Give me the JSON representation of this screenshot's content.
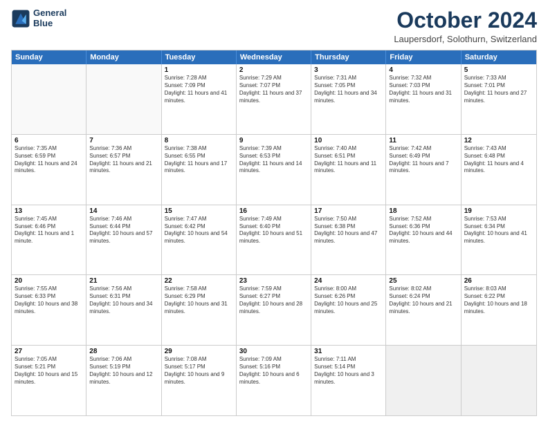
{
  "header": {
    "logo_line1": "General",
    "logo_line2": "Blue",
    "month_title": "October 2024",
    "subtitle": "Laupersdorf, Solothurn, Switzerland"
  },
  "weekdays": [
    "Sunday",
    "Monday",
    "Tuesday",
    "Wednesday",
    "Thursday",
    "Friday",
    "Saturday"
  ],
  "rows": [
    [
      {
        "day": "",
        "text": "",
        "empty": true
      },
      {
        "day": "",
        "text": "",
        "empty": true
      },
      {
        "day": "1",
        "text": "Sunrise: 7:28 AM\nSunset: 7:09 PM\nDaylight: 11 hours and 41 minutes."
      },
      {
        "day": "2",
        "text": "Sunrise: 7:29 AM\nSunset: 7:07 PM\nDaylight: 11 hours and 37 minutes."
      },
      {
        "day": "3",
        "text": "Sunrise: 7:31 AM\nSunset: 7:05 PM\nDaylight: 11 hours and 34 minutes."
      },
      {
        "day": "4",
        "text": "Sunrise: 7:32 AM\nSunset: 7:03 PM\nDaylight: 11 hours and 31 minutes."
      },
      {
        "day": "5",
        "text": "Sunrise: 7:33 AM\nSunset: 7:01 PM\nDaylight: 11 hours and 27 minutes."
      }
    ],
    [
      {
        "day": "6",
        "text": "Sunrise: 7:35 AM\nSunset: 6:59 PM\nDaylight: 11 hours and 24 minutes."
      },
      {
        "day": "7",
        "text": "Sunrise: 7:36 AM\nSunset: 6:57 PM\nDaylight: 11 hours and 21 minutes."
      },
      {
        "day": "8",
        "text": "Sunrise: 7:38 AM\nSunset: 6:55 PM\nDaylight: 11 hours and 17 minutes."
      },
      {
        "day": "9",
        "text": "Sunrise: 7:39 AM\nSunset: 6:53 PM\nDaylight: 11 hours and 14 minutes."
      },
      {
        "day": "10",
        "text": "Sunrise: 7:40 AM\nSunset: 6:51 PM\nDaylight: 11 hours and 11 minutes."
      },
      {
        "day": "11",
        "text": "Sunrise: 7:42 AM\nSunset: 6:49 PM\nDaylight: 11 hours and 7 minutes."
      },
      {
        "day": "12",
        "text": "Sunrise: 7:43 AM\nSunset: 6:48 PM\nDaylight: 11 hours and 4 minutes."
      }
    ],
    [
      {
        "day": "13",
        "text": "Sunrise: 7:45 AM\nSunset: 6:46 PM\nDaylight: 11 hours and 1 minute."
      },
      {
        "day": "14",
        "text": "Sunrise: 7:46 AM\nSunset: 6:44 PM\nDaylight: 10 hours and 57 minutes."
      },
      {
        "day": "15",
        "text": "Sunrise: 7:47 AM\nSunset: 6:42 PM\nDaylight: 10 hours and 54 minutes."
      },
      {
        "day": "16",
        "text": "Sunrise: 7:49 AM\nSunset: 6:40 PM\nDaylight: 10 hours and 51 minutes."
      },
      {
        "day": "17",
        "text": "Sunrise: 7:50 AM\nSunset: 6:38 PM\nDaylight: 10 hours and 47 minutes."
      },
      {
        "day": "18",
        "text": "Sunrise: 7:52 AM\nSunset: 6:36 PM\nDaylight: 10 hours and 44 minutes."
      },
      {
        "day": "19",
        "text": "Sunrise: 7:53 AM\nSunset: 6:34 PM\nDaylight: 10 hours and 41 minutes."
      }
    ],
    [
      {
        "day": "20",
        "text": "Sunrise: 7:55 AM\nSunset: 6:33 PM\nDaylight: 10 hours and 38 minutes."
      },
      {
        "day": "21",
        "text": "Sunrise: 7:56 AM\nSunset: 6:31 PM\nDaylight: 10 hours and 34 minutes."
      },
      {
        "day": "22",
        "text": "Sunrise: 7:58 AM\nSunset: 6:29 PM\nDaylight: 10 hours and 31 minutes."
      },
      {
        "day": "23",
        "text": "Sunrise: 7:59 AM\nSunset: 6:27 PM\nDaylight: 10 hours and 28 minutes."
      },
      {
        "day": "24",
        "text": "Sunrise: 8:00 AM\nSunset: 6:26 PM\nDaylight: 10 hours and 25 minutes."
      },
      {
        "day": "25",
        "text": "Sunrise: 8:02 AM\nSunset: 6:24 PM\nDaylight: 10 hours and 21 minutes."
      },
      {
        "day": "26",
        "text": "Sunrise: 8:03 AM\nSunset: 6:22 PM\nDaylight: 10 hours and 18 minutes."
      }
    ],
    [
      {
        "day": "27",
        "text": "Sunrise: 7:05 AM\nSunset: 5:21 PM\nDaylight: 10 hours and 15 minutes."
      },
      {
        "day": "28",
        "text": "Sunrise: 7:06 AM\nSunset: 5:19 PM\nDaylight: 10 hours and 12 minutes."
      },
      {
        "day": "29",
        "text": "Sunrise: 7:08 AM\nSunset: 5:17 PM\nDaylight: 10 hours and 9 minutes."
      },
      {
        "day": "30",
        "text": "Sunrise: 7:09 AM\nSunset: 5:16 PM\nDaylight: 10 hours and 6 minutes."
      },
      {
        "day": "31",
        "text": "Sunrise: 7:11 AM\nSunset: 5:14 PM\nDaylight: 10 hours and 3 minutes."
      },
      {
        "day": "",
        "text": "",
        "empty": true,
        "shaded": true
      },
      {
        "day": "",
        "text": "",
        "empty": true,
        "shaded": true
      }
    ]
  ]
}
